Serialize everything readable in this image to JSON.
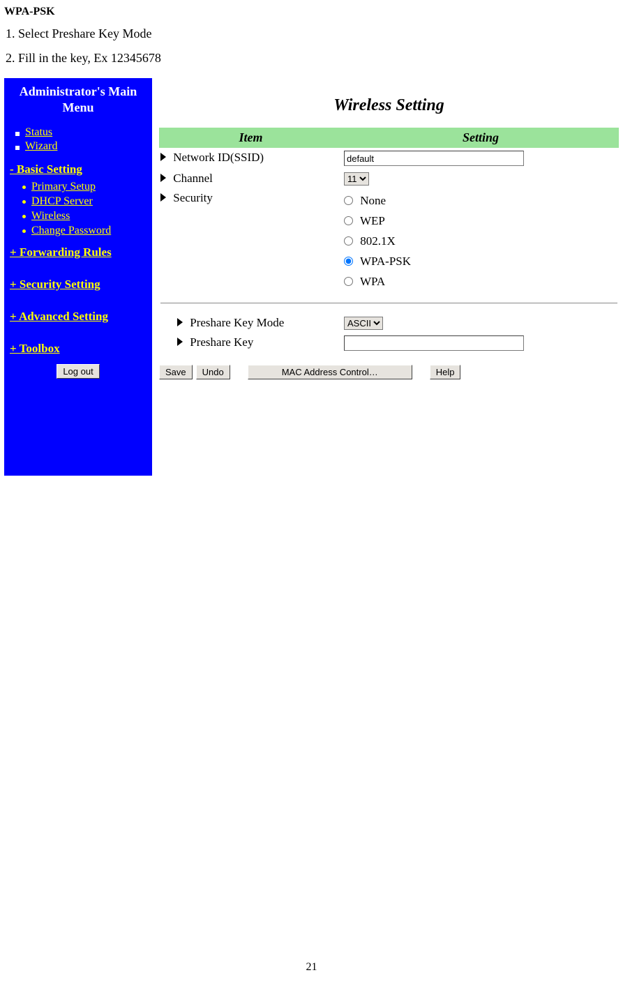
{
  "doc": {
    "heading": "WPA-PSK",
    "step1": "1. Select Preshare Key Mode",
    "step2": "2. Fill in the key, Ex 12345678",
    "page_number": "21"
  },
  "sidebar": {
    "title_line1": "Administrator's Main",
    "title_line2": "Menu",
    "status": "Status",
    "wizard": "Wizard",
    "basic": {
      "title": "- Basic Setting",
      "primary": "Primary Setup",
      "dhcp": "DHCP Server",
      "wireless": "Wireless",
      "password": "Change Password"
    },
    "forwarding": "+ Forwarding Rules",
    "security": "+ Security Setting",
    "advanced": "+ Advanced Setting",
    "toolbox": "+ Toolbox",
    "logout": "Log out"
  },
  "content": {
    "title": "Wireless Setting",
    "hdr_item": "Item",
    "hdr_setting": "Setting",
    "ssid_label": "Network ID(SSID)",
    "ssid_value": "default",
    "channel_label": "Channel",
    "channel_value": "11",
    "security_label": "Security",
    "security": {
      "none": "None",
      "wep": "WEP",
      "dot1x": "802.1X",
      "wpapsk": "WPA-PSK",
      "wpa": "WPA"
    },
    "pkeymode_label": "Preshare Key Mode",
    "pkeymode_value": "ASCII",
    "pkey_label": "Preshare Key",
    "pkey_value": "",
    "buttons": {
      "save": "Save",
      "undo": "Undo",
      "mac": "MAC Address Control…",
      "help": "Help"
    }
  }
}
